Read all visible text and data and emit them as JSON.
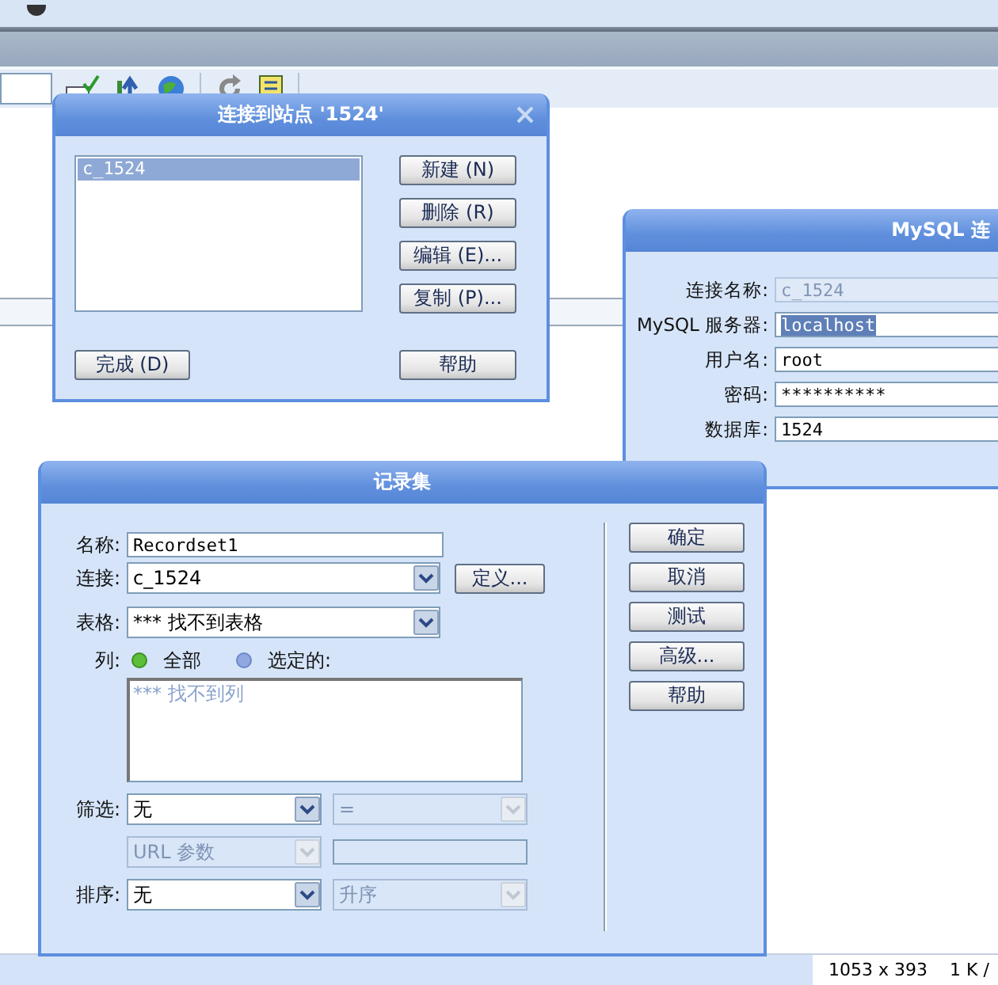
{
  "status_bar": {
    "dimensions": "1053 x 393",
    "size": "1 K /"
  },
  "sites_dialog": {
    "title": "连接到站点 '1524'",
    "connections": [
      {
        "label": "c_1524",
        "selected": true
      }
    ],
    "buttons": [
      "新建 (N)",
      "删除 (R)",
      "编辑 (E)...",
      "复制 (P)..."
    ],
    "done_button": "完成 (D)",
    "help_button": "帮助"
  },
  "mysql_dialog": {
    "title": "MySQL 连",
    "fields": [
      {
        "label": "连接名称:",
        "value": "c_1524",
        "disabled": true,
        "highlighted": false
      },
      {
        "label": "MySQL 服务器:",
        "value": "localhost",
        "disabled": false,
        "highlighted": true
      },
      {
        "label": "用户名:",
        "value": "root",
        "disabled": false,
        "highlighted": false
      },
      {
        "label": "密码:",
        "value": "**********",
        "disabled": false,
        "highlighted": false
      },
      {
        "label": "数据库:",
        "value": "1524",
        "disabled": false,
        "highlighted": false
      }
    ]
  },
  "recordset_dialog": {
    "title": "记录集",
    "name": {
      "label": "名称:",
      "value": "Recordset1"
    },
    "connection": {
      "label": "连接:",
      "value": "c_1524",
      "define_button": "定义..."
    },
    "table": {
      "label": "表格:",
      "value": "*** 找不到表格"
    },
    "columns": {
      "label": "列:",
      "options": [
        {
          "label": "全部",
          "selected": true
        },
        {
          "label": "选定的:",
          "selected": false
        }
      ],
      "list_text": "*** 找不到列"
    },
    "filter": {
      "label": "筛选:",
      "field": {
        "value": "无",
        "disabled": false
      },
      "operator": {
        "value": "=",
        "disabled": true
      },
      "source": {
        "value": "URL 参数",
        "disabled": true
      }
    },
    "sort": {
      "label": "排序:",
      "field": {
        "value": "无",
        "disabled": false
      },
      "order": {
        "value": "升序",
        "disabled": true
      }
    },
    "buttons": [
      "确定",
      "取消",
      "测试",
      "高级...",
      "帮助"
    ]
  }
}
